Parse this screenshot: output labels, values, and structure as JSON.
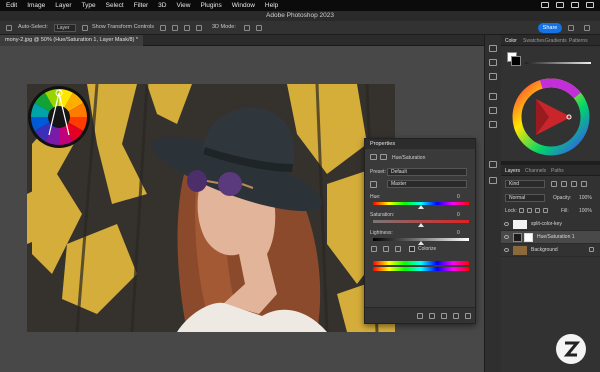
{
  "menubar": {
    "items": [
      "Edit",
      "Image",
      "Layer",
      "Type",
      "Select",
      "Filter",
      "3D",
      "View",
      "Plugins",
      "Window",
      "Help"
    ]
  },
  "window": {
    "title": "Adobe Photoshop 2023"
  },
  "options_bar": {
    "auto_select_label": "Auto-Select:",
    "target_value": "Layer",
    "show_transform_label": "Show Transform Controls",
    "mode_3d_label": "3D Mode:",
    "share_label": "Share"
  },
  "document": {
    "tab_title": "mony-2.jpg @ 50% (Hue/Saturation 1, Layer Mask/8) *"
  },
  "color_panel": {
    "tabs": [
      "Color",
      "Swatches",
      "Gradients",
      "Patterns"
    ],
    "active_tab": "Color"
  },
  "properties": {
    "title": "Properties",
    "adjustment_name": "Hue/Saturation",
    "preset_label": "Preset:",
    "preset_value": "Default",
    "channel_value": "Master",
    "hue_label": "Hue:",
    "hue_value": "0",
    "saturation_label": "Saturation:",
    "saturation_value": "0",
    "lightness_label": "Lightness:",
    "lightness_value": "0",
    "colorize_label": "Colorize"
  },
  "layers_panel": {
    "tabs": [
      "Layers",
      "Channels",
      "Paths"
    ],
    "active_tab": "Layers",
    "kind_label": "Kind",
    "blend_mode": "Normal",
    "opacity_label": "Opacity:",
    "opacity_value": "100%",
    "lock_label": "Lock:",
    "fill_label": "Fill:",
    "fill_value": "100%",
    "layers": [
      {
        "name": "split-color-key",
        "selected": false
      },
      {
        "name": "Hue/Saturation 1",
        "selected": true
      },
      {
        "name": "Background",
        "selected": false
      }
    ]
  },
  "colors": {
    "accent": "#1473e6",
    "panel_bg": "#323232",
    "canvas_bg": "#484848",
    "wall_yellow": "#e3b83c"
  },
  "icons": [
    "move-tool-icon",
    "color-wheel-icon",
    "eye-icon",
    "lock-icon",
    "trash-icon",
    "add-layer-icon",
    "mask-icon"
  ]
}
